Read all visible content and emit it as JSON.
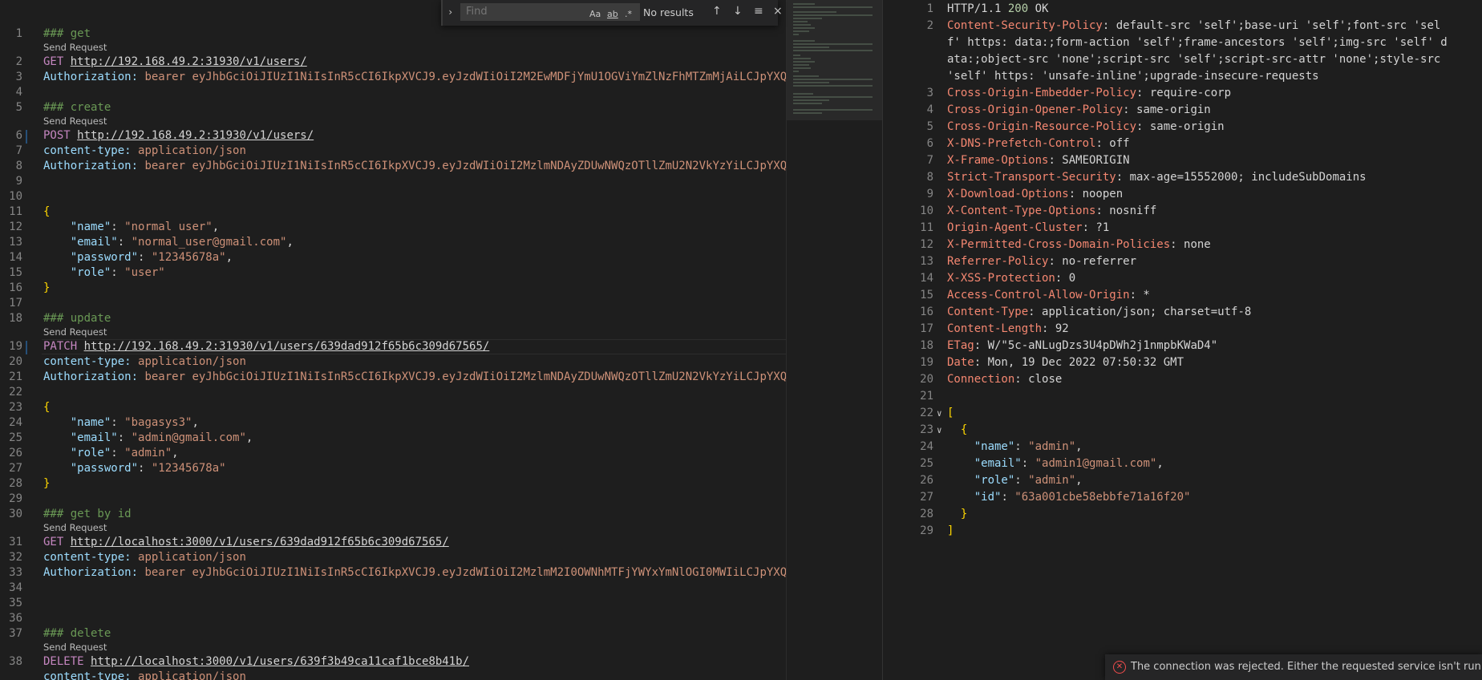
{
  "find": {
    "placeholder": "Find",
    "toggle_icon": "chevron-right-icon",
    "match_case": "Aa",
    "whole_word": "ab",
    "regex": ".*",
    "results": "No results"
  },
  "left_lines": [
    {
      "n": "1",
      "parts": [
        [
          "comment",
          "### get"
        ]
      ],
      "send": "Send Request"
    },
    {
      "n": "2",
      "parts": [
        [
          "kw",
          "GET "
        ],
        [
          "url",
          "http://192.168.49.2:31930/v1/users/"
        ]
      ]
    },
    {
      "n": "3",
      "parts": [
        [
          "hdr",
          "Authorization: "
        ],
        [
          "val",
          "bearer eyJhbGciOiJIUzI1NiIsInR5cCI6IkpXVCJ9.eyJzdWIiOiI2M2EwMDFjYmU1OGViYmZlNzFhMTZmMjAiLCJpYXQ"
        ]
      ]
    },
    {
      "n": "4",
      "parts": []
    },
    {
      "n": "5",
      "parts": [
        [
          "comment",
          "### create"
        ]
      ],
      "send": "Send Request"
    },
    {
      "n": "6",
      "parts": [
        [
          "kw",
          "POST "
        ],
        [
          "url",
          "http://192.168.49.2:31930/v1/users/"
        ]
      ],
      "mark": true
    },
    {
      "n": "7",
      "parts": [
        [
          "hdr",
          "content-type: "
        ],
        [
          "val",
          "application/json"
        ]
      ]
    },
    {
      "n": "8",
      "parts": [
        [
          "hdr",
          "Authorization: "
        ],
        [
          "val",
          "bearer eyJhbGciOiJIUzI1NiIsInR5cCI6IkpXVCJ9.eyJzdWIiOiI2MzlmNDAyZDUwNWQzOTllZmU2N2VkYzYiLCJpYXQ"
        ]
      ]
    },
    {
      "n": "9",
      "parts": []
    },
    {
      "n": "10",
      "parts": []
    },
    {
      "n": "11",
      "parts": [
        [
          "brace",
          "{"
        ]
      ]
    },
    {
      "n": "12",
      "parts": [
        [
          "text",
          "    "
        ],
        [
          "key",
          "\"name\""
        ],
        [
          "text",
          ": "
        ],
        [
          "val",
          "\"normal user\""
        ],
        [
          "text",
          ","
        ]
      ]
    },
    {
      "n": "13",
      "parts": [
        [
          "text",
          "    "
        ],
        [
          "key",
          "\"email\""
        ],
        [
          "text",
          ": "
        ],
        [
          "val",
          "\"normal_user@gmail.com\""
        ],
        [
          "text",
          ","
        ]
      ]
    },
    {
      "n": "14",
      "parts": [
        [
          "text",
          "    "
        ],
        [
          "key",
          "\"password\""
        ],
        [
          "text",
          ": "
        ],
        [
          "val",
          "\"12345678a\""
        ],
        [
          "text",
          ","
        ]
      ]
    },
    {
      "n": "15",
      "parts": [
        [
          "text",
          "    "
        ],
        [
          "key",
          "\"role\""
        ],
        [
          "text",
          ": "
        ],
        [
          "val",
          "\"user\""
        ]
      ]
    },
    {
      "n": "16",
      "parts": [
        [
          "brace",
          "}"
        ]
      ]
    },
    {
      "n": "17",
      "parts": []
    },
    {
      "n": "18",
      "parts": [
        [
          "comment",
          "### update"
        ]
      ],
      "send": "Send Request"
    },
    {
      "n": "19",
      "parts": [
        [
          "kw",
          "PATCH "
        ],
        [
          "url",
          "http://192.168.49.2:31930/v1/users/639dad912f65b6c309d67565/"
        ]
      ],
      "mark": true,
      "current": true
    },
    {
      "n": "20",
      "parts": [
        [
          "hdr",
          "content-type: "
        ],
        [
          "val",
          "application/json"
        ]
      ]
    },
    {
      "n": "21",
      "parts": [
        [
          "hdr",
          "Authorization: "
        ],
        [
          "val",
          "bearer eyJhbGciOiJIUzI1NiIsInR5cCI6IkpXVCJ9.eyJzdWIiOiI2MzlmNDAyZDUwNWQzOTllZmU2N2VkYzYiLCJpYXQ"
        ]
      ]
    },
    {
      "n": "22",
      "parts": []
    },
    {
      "n": "23",
      "parts": [
        [
          "brace",
          "{"
        ]
      ]
    },
    {
      "n": "24",
      "parts": [
        [
          "text",
          "    "
        ],
        [
          "key",
          "\"name\""
        ],
        [
          "text",
          ": "
        ],
        [
          "val",
          "\"bagasys3\""
        ],
        [
          "text",
          ","
        ]
      ]
    },
    {
      "n": "25",
      "parts": [
        [
          "text",
          "    "
        ],
        [
          "key",
          "\"email\""
        ],
        [
          "text",
          ": "
        ],
        [
          "val",
          "\"admin@gmail.com\""
        ],
        [
          "text",
          ","
        ]
      ]
    },
    {
      "n": "26",
      "parts": [
        [
          "text",
          "    "
        ],
        [
          "key",
          "\"role\""
        ],
        [
          "text",
          ": "
        ],
        [
          "val",
          "\"admin\""
        ],
        [
          "text",
          ","
        ]
      ]
    },
    {
      "n": "27",
      "parts": [
        [
          "text",
          "    "
        ],
        [
          "key",
          "\"password\""
        ],
        [
          "text",
          ": "
        ],
        [
          "val",
          "\"12345678a\""
        ]
      ]
    },
    {
      "n": "28",
      "parts": [
        [
          "brace",
          "}"
        ]
      ]
    },
    {
      "n": "29",
      "parts": []
    },
    {
      "n": "30",
      "parts": [
        [
          "comment",
          "### get by id"
        ]
      ],
      "send": "Send Request"
    },
    {
      "n": "31",
      "parts": [
        [
          "kw",
          "GET "
        ],
        [
          "url",
          "http://localhost:3000/v1/users/639dad912f65b6c309d67565/"
        ]
      ]
    },
    {
      "n": "32",
      "parts": [
        [
          "hdr",
          "content-type: "
        ],
        [
          "val",
          "application/json"
        ]
      ]
    },
    {
      "n": "33",
      "parts": [
        [
          "hdr",
          "Authorization: "
        ],
        [
          "val",
          "bearer eyJhbGciOiJIUzI1NiIsInR5cCI6IkpXVCJ9.eyJzdWIiOiI2MzlmM2I0OWNhMTFjYWYxYmNlOGI0MWIiLCJpYXQ"
        ]
      ]
    },
    {
      "n": "34",
      "parts": []
    },
    {
      "n": "35",
      "parts": []
    },
    {
      "n": "36",
      "parts": []
    },
    {
      "n": "37",
      "parts": [
        [
          "comment",
          "### delete"
        ]
      ],
      "send": "Send Request"
    },
    {
      "n": "38",
      "parts": [
        [
          "kw",
          "DELETE "
        ],
        [
          "url",
          "http://localhost:3000/v1/users/639f3b49ca11caf1bce8b41b/"
        ]
      ]
    },
    {
      "n": "",
      "parts": [
        [
          "hdr",
          "content-type: "
        ],
        [
          "val",
          "application/json"
        ]
      ]
    }
  ],
  "right_lines": [
    {
      "n": "1",
      "parts": [
        [
          "text",
          "HTTP/1.1 "
        ],
        [
          "rnum",
          "200"
        ],
        [
          "text",
          " OK"
        ]
      ]
    },
    {
      "n": "2",
      "parts": [
        [
          "rkey",
          "Content-Security-Policy"
        ],
        [
          "text",
          ": default-src 'self';base-uri 'self';font-src 'sel"
        ]
      ]
    },
    {
      "n": "",
      "parts": [
        [
          "text",
          "f' https: data:;form-action 'self';frame-ancestors 'self';img-src 'self' d"
        ]
      ]
    },
    {
      "n": "",
      "parts": [
        [
          "text",
          "ata:;object-src 'none';script-src 'self';script-src-attr 'none';style-src"
        ]
      ]
    },
    {
      "n": "",
      "parts": [
        [
          "text",
          "'self' https: 'unsafe-inline';upgrade-insecure-requests"
        ]
      ]
    },
    {
      "n": "3",
      "parts": [
        [
          "rkey",
          "Cross-Origin-Embedder-Policy"
        ],
        [
          "text",
          ": require-corp"
        ]
      ]
    },
    {
      "n": "4",
      "parts": [
        [
          "rkey",
          "Cross-Origin-Opener-Policy"
        ],
        [
          "text",
          ": same-origin"
        ]
      ]
    },
    {
      "n": "5",
      "parts": [
        [
          "rkey",
          "Cross-Origin-Resource-Policy"
        ],
        [
          "text",
          ": same-origin"
        ]
      ]
    },
    {
      "n": "6",
      "parts": [
        [
          "rkey",
          "X-DNS-Prefetch-Control"
        ],
        [
          "text",
          ": off"
        ]
      ]
    },
    {
      "n": "7",
      "parts": [
        [
          "rkey",
          "X-Frame-Options"
        ],
        [
          "text",
          ": SAMEORIGIN"
        ]
      ]
    },
    {
      "n": "8",
      "parts": [
        [
          "rkey",
          "Strict-Transport-Security"
        ],
        [
          "text",
          ": max-age=15552000; includeSubDomains"
        ]
      ]
    },
    {
      "n": "9",
      "parts": [
        [
          "rkey",
          "X-Download-Options"
        ],
        [
          "text",
          ": noopen"
        ]
      ]
    },
    {
      "n": "10",
      "parts": [
        [
          "rkey",
          "X-Content-Type-Options"
        ],
        [
          "text",
          ": nosniff"
        ]
      ]
    },
    {
      "n": "11",
      "parts": [
        [
          "rkey",
          "Origin-Agent-Cluster"
        ],
        [
          "text",
          ": ?1"
        ]
      ]
    },
    {
      "n": "12",
      "parts": [
        [
          "rkey",
          "X-Permitted-Cross-Domain-Policies"
        ],
        [
          "text",
          ": none"
        ]
      ]
    },
    {
      "n": "13",
      "parts": [
        [
          "rkey",
          "Referrer-Policy"
        ],
        [
          "text",
          ": no-referrer"
        ]
      ]
    },
    {
      "n": "14",
      "parts": [
        [
          "rkey",
          "X-XSS-Protection"
        ],
        [
          "text",
          ": 0"
        ]
      ]
    },
    {
      "n": "15",
      "parts": [
        [
          "rkey",
          "Access-Control-Allow-Origin"
        ],
        [
          "text",
          ": *"
        ]
      ]
    },
    {
      "n": "16",
      "parts": [
        [
          "rkey",
          "Content-Type"
        ],
        [
          "text",
          ": application/json; charset=utf-8"
        ]
      ]
    },
    {
      "n": "17",
      "parts": [
        [
          "rkey",
          "Content-Length"
        ],
        [
          "text",
          ": 92"
        ]
      ]
    },
    {
      "n": "18",
      "parts": [
        [
          "rkey",
          "ETag"
        ],
        [
          "text",
          ": W/\"5c-aNLugDzs3U4pDWh2j1nmpbKWaD4\""
        ]
      ]
    },
    {
      "n": "19",
      "parts": [
        [
          "rkey",
          "Date"
        ],
        [
          "text",
          ": Mon, 19 Dec 2022 07:50:32 GMT"
        ]
      ]
    },
    {
      "n": "20",
      "parts": [
        [
          "rkey",
          "Connection"
        ],
        [
          "text",
          ": close"
        ]
      ]
    },
    {
      "n": "21",
      "parts": []
    },
    {
      "n": "22",
      "parts": [
        [
          "brace",
          "["
        ]
      ],
      "fold": true
    },
    {
      "n": "23",
      "parts": [
        [
          "text",
          "  "
        ],
        [
          "brace",
          "{"
        ]
      ],
      "fold": true
    },
    {
      "n": "24",
      "parts": [
        [
          "text",
          "    "
        ],
        [
          "key",
          "\"name\""
        ],
        [
          "text",
          ": "
        ],
        [
          "val",
          "\"admin\""
        ],
        [
          "text",
          ","
        ]
      ]
    },
    {
      "n": "25",
      "parts": [
        [
          "text",
          "    "
        ],
        [
          "key",
          "\"email\""
        ],
        [
          "text",
          ": "
        ],
        [
          "val",
          "\"admin1@gmail.com\""
        ],
        [
          "text",
          ","
        ]
      ]
    },
    {
      "n": "26",
      "parts": [
        [
          "text",
          "    "
        ],
        [
          "key",
          "\"role\""
        ],
        [
          "text",
          ": "
        ],
        [
          "val",
          "\"admin\""
        ],
        [
          "text",
          ","
        ]
      ]
    },
    {
      "n": "27",
      "parts": [
        [
          "text",
          "    "
        ],
        [
          "key",
          "\"id\""
        ],
        [
          "text",
          ": "
        ],
        [
          "val",
          "\"63a001cbe58ebbfe71a16f20\""
        ]
      ]
    },
    {
      "n": "28",
      "parts": [
        [
          "text",
          "  "
        ],
        [
          "brace",
          "}"
        ]
      ]
    },
    {
      "n": "29",
      "parts": [
        [
          "brace",
          "]"
        ]
      ]
    }
  ],
  "toast": {
    "icon": "error-icon",
    "message": "The connection was rejected. Either the requested service isn't runni..."
  },
  "colors": {
    "comment": "#6a9955",
    "keyword": "#c586c0",
    "header": "#9cdcfe",
    "string": "#ce9178",
    "response_key": "#f48771",
    "status": "#b5cea8"
  }
}
